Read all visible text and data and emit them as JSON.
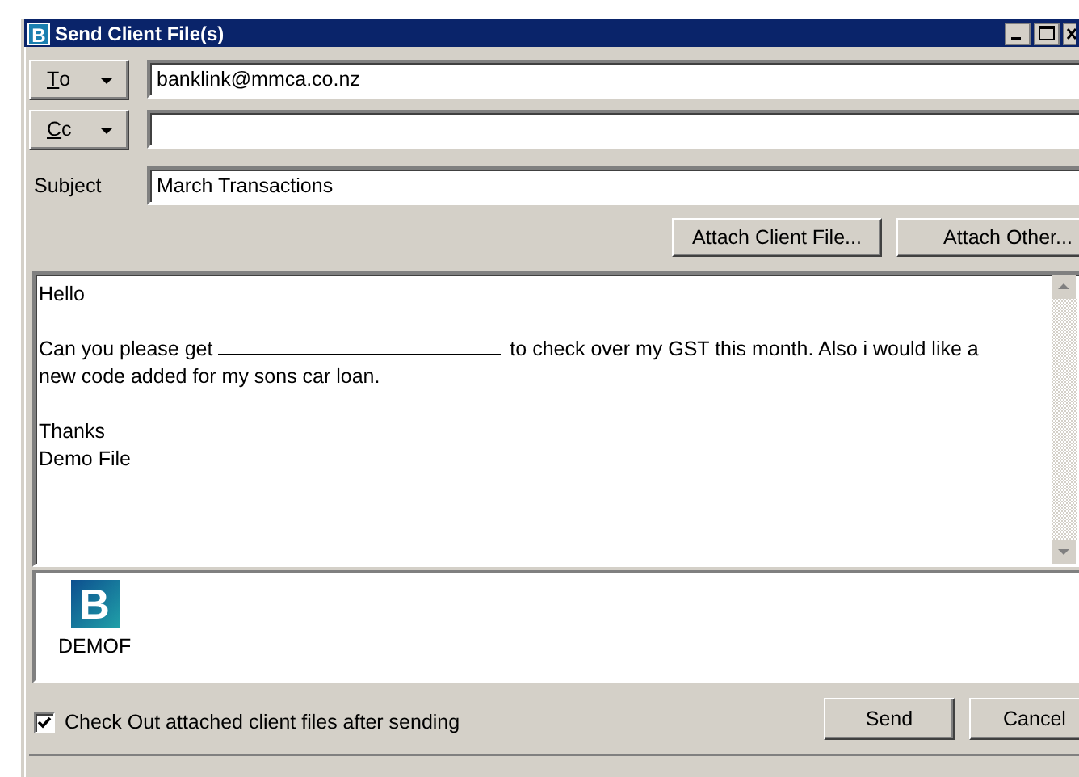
{
  "window": {
    "title": "Send Client File(s)",
    "icon_letter": "B"
  },
  "to": {
    "label": "To",
    "value": "banklink@mmca.co.nz"
  },
  "cc": {
    "label": "Cc"
  },
  "subject": {
    "label": "Subject",
    "value": "March Transactions"
  },
  "attach_buttons": [
    "Attach Client File...",
    "Attach Other..."
  ],
  "body": {
    "paragraphs": [
      {
        "kind": "text",
        "lines": [
          "Hello"
        ]
      },
      {
        "kind": "blank",
        "before": "Can you please get",
        "after": "to check over my GST this month.   Also i would like a new code added for my sons car loan."
      },
      {
        "kind": "text",
        "lines": [
          "Thanks",
          "Demo File"
        ]
      }
    ]
  },
  "attachments": [
    {
      "letter": "B",
      "name": "DEMOF"
    }
  ],
  "checkout": {
    "label": "Check Out attached client files after sending",
    "checked": true
  },
  "buttons": [
    "Send",
    "Cancel"
  ]
}
